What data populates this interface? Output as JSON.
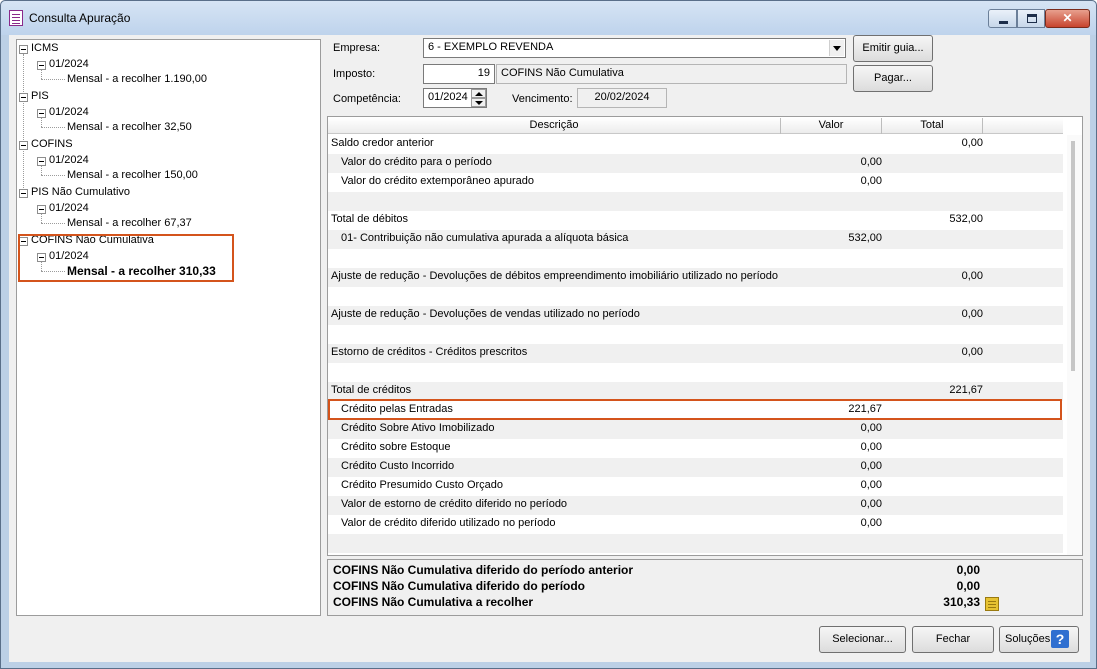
{
  "window": {
    "title": "Consulta Apuração"
  },
  "tree": {
    "groups": [
      {
        "label": "ICMS",
        "period": "01/2024",
        "item": "Mensal - a recolher 1.190,00"
      },
      {
        "label": "PIS",
        "period": "01/2024",
        "item": "Mensal - a recolher 32,50"
      },
      {
        "label": "COFINS",
        "period": "01/2024",
        "item": "Mensal - a recolher 150,00"
      },
      {
        "label": "PIS Não Cumulativo",
        "period": "01/2024",
        "item": "Mensal - a recolher 67,37"
      },
      {
        "label": "COFINS Não Cumulativa",
        "period": "01/2024",
        "item": "Mensal - a recolher 310,33"
      }
    ]
  },
  "form": {
    "empresa_label": "Empresa:",
    "empresa_value": "6 - EXEMPLO REVENDA",
    "imposto_label": "Imposto:",
    "imposto_code": "19",
    "imposto_name": "COFINS Não Cumulativa",
    "competencia_label": "Competência:",
    "competencia_value": "01/2024",
    "vencimento_label": "Vencimento:",
    "vencimento_value": "20/02/2024",
    "emitir_guia_label": "Emitir guia...",
    "pagar_label": "Pagar..."
  },
  "grid": {
    "columns": [
      "Descrição",
      "Valor",
      "Total"
    ],
    "rows": [
      {
        "desc": "Saldo credor anterior",
        "indent": false,
        "valor": "",
        "total": "0,00"
      },
      {
        "desc": "Valor do crédito para o período",
        "indent": true,
        "valor": "0,00",
        "total": ""
      },
      {
        "desc": "Valor do crédito extemporâneo apurado",
        "indent": true,
        "valor": "0,00",
        "total": ""
      },
      {
        "desc": "",
        "indent": false,
        "valor": "",
        "total": ""
      },
      {
        "desc": "Total de débitos",
        "indent": false,
        "valor": "",
        "total": "532,00"
      },
      {
        "desc": "01- Contribuição não cumulativa apurada a alíquota básica",
        "indent": true,
        "valor": "532,00",
        "total": ""
      },
      {
        "desc": "",
        "indent": false,
        "valor": "",
        "total": ""
      },
      {
        "desc": "Ajuste de redução - Devoluções de débitos empreendimento imobiliário utilizado no período",
        "indent": false,
        "valor": "",
        "total": "0,00"
      },
      {
        "desc": "",
        "indent": false,
        "valor": "",
        "total": ""
      },
      {
        "desc": "Ajuste de redução - Devoluções de vendas utilizado no período",
        "indent": false,
        "valor": "",
        "total": "0,00"
      },
      {
        "desc": "",
        "indent": false,
        "valor": "",
        "total": ""
      },
      {
        "desc": "Estorno de créditos - Créditos prescritos",
        "indent": false,
        "valor": "",
        "total": "0,00"
      },
      {
        "desc": "",
        "indent": false,
        "valor": "",
        "total": ""
      },
      {
        "desc": "Total de créditos",
        "indent": false,
        "valor": "",
        "total": "221,67"
      },
      {
        "desc": "Crédito pelas Entradas",
        "indent": true,
        "valor": "221,67",
        "total": ""
      },
      {
        "desc": "Crédito Sobre Ativo Imobilizado",
        "indent": true,
        "valor": "0,00",
        "total": ""
      },
      {
        "desc": "Crédito sobre Estoque",
        "indent": true,
        "valor": "0,00",
        "total": ""
      },
      {
        "desc": "Crédito Custo Incorrido",
        "indent": true,
        "valor": "0,00",
        "total": ""
      },
      {
        "desc": "Crédito Presumido Custo Orçado",
        "indent": true,
        "valor": "0,00",
        "total": ""
      },
      {
        "desc": "Valor de estorno de crédito diferido no período",
        "indent": true,
        "valor": "0,00",
        "total": ""
      },
      {
        "desc": "Valor de crédito diferido utilizado no período",
        "indent": true,
        "valor": "0,00",
        "total": ""
      },
      {
        "desc": "",
        "indent": false,
        "valor": "",
        "total": ""
      }
    ]
  },
  "summary": {
    "rows": [
      {
        "label": "COFINS Não Cumulativa diferido do período anterior",
        "value": "0,00"
      },
      {
        "label": "COFINS Não Cumulativa diferido do período",
        "value": "0,00"
      },
      {
        "label": "COFINS Não Cumulativa a recolher",
        "value": "310,33"
      }
    ]
  },
  "footer": {
    "selecionar_label": "Selecionar...",
    "fechar_label": "Fechar",
    "solucoes_label": "Soluções",
    "help_glyph": "?"
  },
  "highlight_color": "#d4541c"
}
